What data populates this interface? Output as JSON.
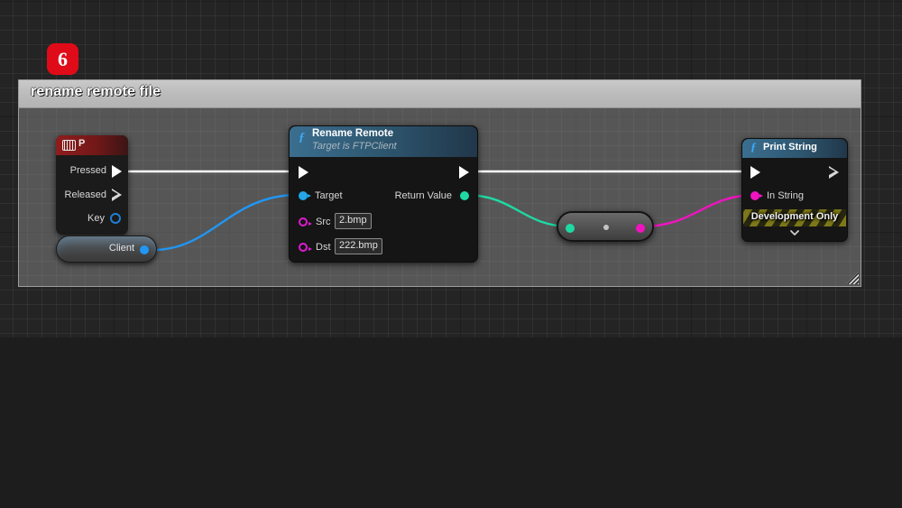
{
  "badge": {
    "number": "6"
  },
  "comment": {
    "title": "rename remote file",
    "resize_handle": "resize-handle"
  },
  "nodes": {
    "key_event": {
      "title": "P",
      "icon": "keyboard-icon",
      "pins": [
        {
          "label": "Pressed",
          "type": "exec-out",
          "color": "#ffffff"
        },
        {
          "label": "Released",
          "type": "exec-out",
          "color": "#d8d8d8"
        },
        {
          "label": "Key",
          "type": "data-out",
          "color": "#1f7fd4"
        }
      ]
    },
    "client_var": {
      "label": "Client",
      "pin_color": "#2196f3"
    },
    "rename_remote": {
      "title": "Rename Remote",
      "subtitle": "Target is FTPClient",
      "icon": "function-f-icon",
      "inputs": [
        {
          "label": "Target",
          "color": "#23a7e8"
        },
        {
          "label": "Src",
          "value": "2.bmp",
          "color": "#e11ad1"
        },
        {
          "label": "Dst",
          "value": "222.bmp",
          "color": "#e11ad1"
        }
      ],
      "outputs": [
        {
          "label": "Return Value",
          "color": "#1fd9a4"
        }
      ]
    },
    "conversion": {
      "label": "",
      "input_pin_color": "#1fd9a4",
      "output_pin_color": "#ef14c0",
      "center_dot": "reroute-dot"
    },
    "print_string": {
      "title": "Print String",
      "icon": "function-f-icon",
      "inputs": [
        {
          "label": "In String",
          "color": "#ef14c0"
        }
      ],
      "banner": "Development Only",
      "expander": "chevron-down-icon"
    }
  },
  "wires": {
    "exec_color": "#ffffff",
    "client_wire_color": "#2196f3",
    "return_wire_color": "#1fd9a4",
    "string_wire_color": "#ef14c0"
  }
}
